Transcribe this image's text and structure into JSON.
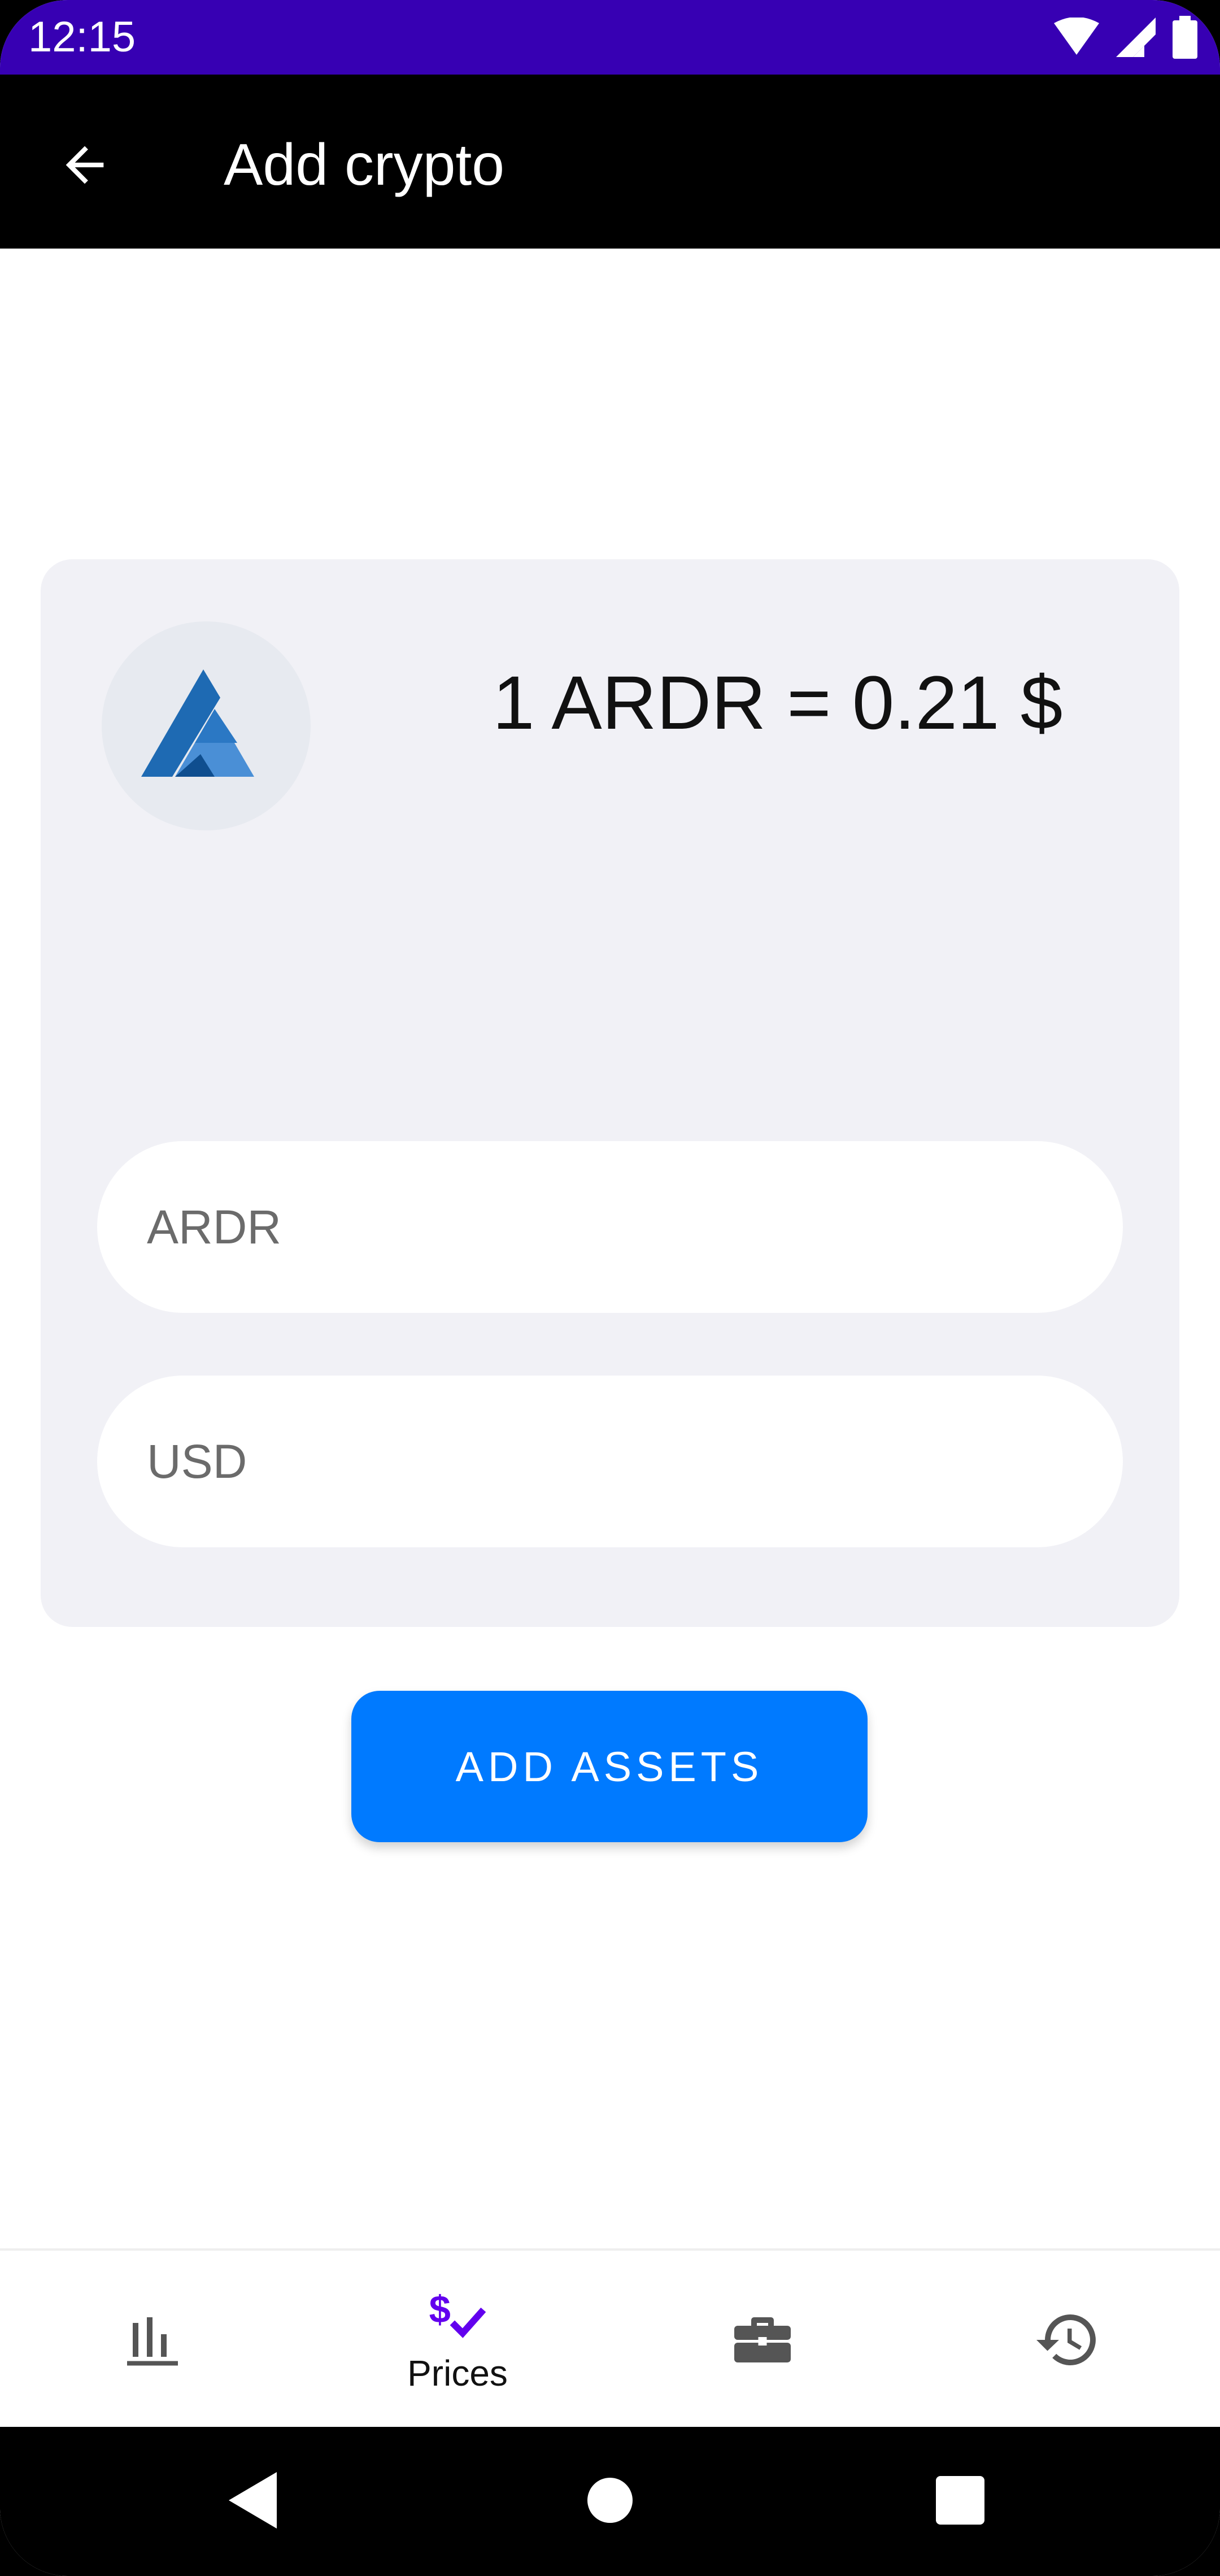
{
  "status_bar": {
    "time": "12:15",
    "icons": [
      "wifi-icon",
      "signal-icon",
      "battery-icon"
    ],
    "background": "#3700B3"
  },
  "app_bar": {
    "title": "Add crypto",
    "back_icon": "arrow-left-icon",
    "background": "#000000"
  },
  "card": {
    "coin_logo": "ardor-logo",
    "rate_text": "1 ARDR = 0.21 $",
    "crypto_input": {
      "placeholder": "ARDR",
      "value": ""
    },
    "fiat_input": {
      "placeholder": "USD",
      "value": ""
    }
  },
  "actions": {
    "add_assets_label": "ADD ASSETS",
    "accent": "#007AFF"
  },
  "bottom_nav": {
    "items": [
      {
        "icon": "bar-chart-icon",
        "label": "",
        "active": false
      },
      {
        "icon": "dollar-check-icon",
        "label": "Prices",
        "active": true
      },
      {
        "icon": "briefcase-icon",
        "label": "",
        "active": false
      },
      {
        "icon": "history-icon",
        "label": "",
        "active": false
      }
    ],
    "active_color": "#6200EE"
  },
  "system_nav": {
    "buttons": [
      "back-triangle-icon",
      "home-circle-icon",
      "recents-square-icon"
    ]
  }
}
